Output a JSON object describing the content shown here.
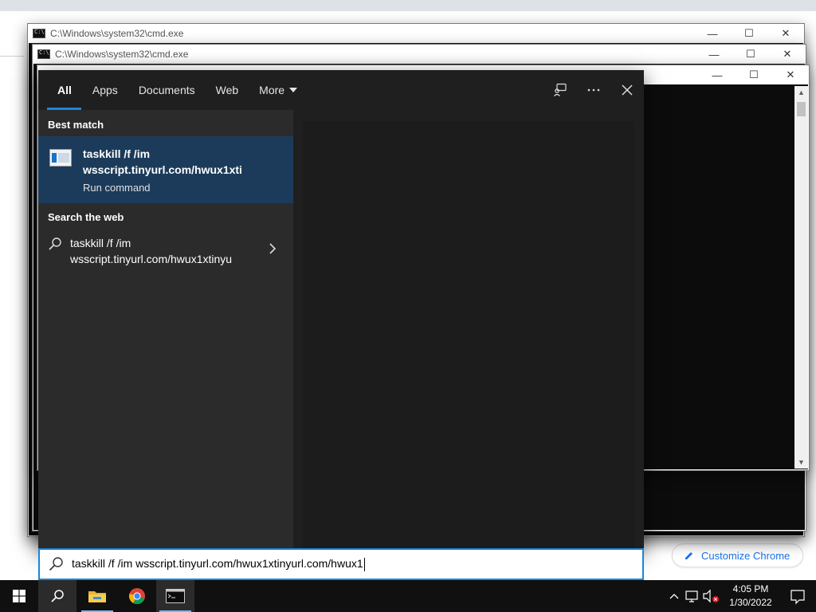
{
  "cmd_windows": [
    {
      "title": "C:\\Windows\\system32\\cmd.exe"
    },
    {
      "title": "C:\\Windows\\system32\\cmd.exe"
    }
  ],
  "cmd_controls": {
    "minimize": "—",
    "maximize": "☐",
    "close": "✕"
  },
  "search": {
    "tabs": [
      "All",
      "Apps",
      "Documents",
      "Web",
      "More"
    ],
    "active_tab": "All",
    "best_match_label": "Best match",
    "best_match": {
      "title_line1": "taskkill /f /im",
      "title_line2": "wsscript.tinyurl.com/hwux1xti",
      "subtitle": "Run command"
    },
    "web_label": "Search the web",
    "web_result": {
      "line1": "taskkill /f /im",
      "line2": "wsscript.tinyurl.com/hwux1xtinyu"
    },
    "query": "taskkill /f /im wsscript.tinyurl.com/hwux1xtinyurl.com/hwux1"
  },
  "browser": {
    "customize_label": "Customize Chrome"
  },
  "taskbar": {
    "time": "4:05 PM",
    "date": "1/30/2022"
  },
  "colors": {
    "accent": "#1a86d9",
    "best_match_bg": "#1c3b5a",
    "panel_bg": "#1f1f1f"
  }
}
